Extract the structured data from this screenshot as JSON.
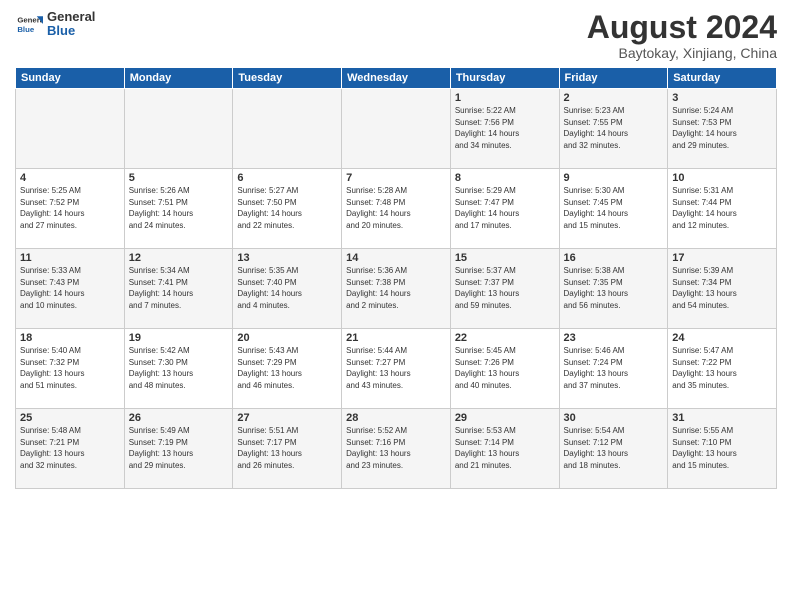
{
  "header": {
    "logo_line1": "General",
    "logo_line2": "Blue",
    "month": "August 2024",
    "location": "Baytokay, Xinjiang, China"
  },
  "weekdays": [
    "Sunday",
    "Monday",
    "Tuesday",
    "Wednesday",
    "Thursday",
    "Friday",
    "Saturday"
  ],
  "weeks": [
    [
      {
        "day": "",
        "info": ""
      },
      {
        "day": "",
        "info": ""
      },
      {
        "day": "",
        "info": ""
      },
      {
        "day": "",
        "info": ""
      },
      {
        "day": "1",
        "info": "Sunrise: 5:22 AM\nSunset: 7:56 PM\nDaylight: 14 hours\nand 34 minutes."
      },
      {
        "day": "2",
        "info": "Sunrise: 5:23 AM\nSunset: 7:55 PM\nDaylight: 14 hours\nand 32 minutes."
      },
      {
        "day": "3",
        "info": "Sunrise: 5:24 AM\nSunset: 7:53 PM\nDaylight: 14 hours\nand 29 minutes."
      }
    ],
    [
      {
        "day": "4",
        "info": "Sunrise: 5:25 AM\nSunset: 7:52 PM\nDaylight: 14 hours\nand 27 minutes."
      },
      {
        "day": "5",
        "info": "Sunrise: 5:26 AM\nSunset: 7:51 PM\nDaylight: 14 hours\nand 24 minutes."
      },
      {
        "day": "6",
        "info": "Sunrise: 5:27 AM\nSunset: 7:50 PM\nDaylight: 14 hours\nand 22 minutes."
      },
      {
        "day": "7",
        "info": "Sunrise: 5:28 AM\nSunset: 7:48 PM\nDaylight: 14 hours\nand 20 minutes."
      },
      {
        "day": "8",
        "info": "Sunrise: 5:29 AM\nSunset: 7:47 PM\nDaylight: 14 hours\nand 17 minutes."
      },
      {
        "day": "9",
        "info": "Sunrise: 5:30 AM\nSunset: 7:45 PM\nDaylight: 14 hours\nand 15 minutes."
      },
      {
        "day": "10",
        "info": "Sunrise: 5:31 AM\nSunset: 7:44 PM\nDaylight: 14 hours\nand 12 minutes."
      }
    ],
    [
      {
        "day": "11",
        "info": "Sunrise: 5:33 AM\nSunset: 7:43 PM\nDaylight: 14 hours\nand 10 minutes."
      },
      {
        "day": "12",
        "info": "Sunrise: 5:34 AM\nSunset: 7:41 PM\nDaylight: 14 hours\nand 7 minutes."
      },
      {
        "day": "13",
        "info": "Sunrise: 5:35 AM\nSunset: 7:40 PM\nDaylight: 14 hours\nand 4 minutes."
      },
      {
        "day": "14",
        "info": "Sunrise: 5:36 AM\nSunset: 7:38 PM\nDaylight: 14 hours\nand 2 minutes."
      },
      {
        "day": "15",
        "info": "Sunrise: 5:37 AM\nSunset: 7:37 PM\nDaylight: 13 hours\nand 59 minutes."
      },
      {
        "day": "16",
        "info": "Sunrise: 5:38 AM\nSunset: 7:35 PM\nDaylight: 13 hours\nand 56 minutes."
      },
      {
        "day": "17",
        "info": "Sunrise: 5:39 AM\nSunset: 7:34 PM\nDaylight: 13 hours\nand 54 minutes."
      }
    ],
    [
      {
        "day": "18",
        "info": "Sunrise: 5:40 AM\nSunset: 7:32 PM\nDaylight: 13 hours\nand 51 minutes."
      },
      {
        "day": "19",
        "info": "Sunrise: 5:42 AM\nSunset: 7:30 PM\nDaylight: 13 hours\nand 48 minutes."
      },
      {
        "day": "20",
        "info": "Sunrise: 5:43 AM\nSunset: 7:29 PM\nDaylight: 13 hours\nand 46 minutes."
      },
      {
        "day": "21",
        "info": "Sunrise: 5:44 AM\nSunset: 7:27 PM\nDaylight: 13 hours\nand 43 minutes."
      },
      {
        "day": "22",
        "info": "Sunrise: 5:45 AM\nSunset: 7:26 PM\nDaylight: 13 hours\nand 40 minutes."
      },
      {
        "day": "23",
        "info": "Sunrise: 5:46 AM\nSunset: 7:24 PM\nDaylight: 13 hours\nand 37 minutes."
      },
      {
        "day": "24",
        "info": "Sunrise: 5:47 AM\nSunset: 7:22 PM\nDaylight: 13 hours\nand 35 minutes."
      }
    ],
    [
      {
        "day": "25",
        "info": "Sunrise: 5:48 AM\nSunset: 7:21 PM\nDaylight: 13 hours\nand 32 minutes."
      },
      {
        "day": "26",
        "info": "Sunrise: 5:49 AM\nSunset: 7:19 PM\nDaylight: 13 hours\nand 29 minutes."
      },
      {
        "day": "27",
        "info": "Sunrise: 5:51 AM\nSunset: 7:17 PM\nDaylight: 13 hours\nand 26 minutes."
      },
      {
        "day": "28",
        "info": "Sunrise: 5:52 AM\nSunset: 7:16 PM\nDaylight: 13 hours\nand 23 minutes."
      },
      {
        "day": "29",
        "info": "Sunrise: 5:53 AM\nSunset: 7:14 PM\nDaylight: 13 hours\nand 21 minutes."
      },
      {
        "day": "30",
        "info": "Sunrise: 5:54 AM\nSunset: 7:12 PM\nDaylight: 13 hours\nand 18 minutes."
      },
      {
        "day": "31",
        "info": "Sunrise: 5:55 AM\nSunset: 7:10 PM\nDaylight: 13 hours\nand 15 minutes."
      }
    ]
  ]
}
